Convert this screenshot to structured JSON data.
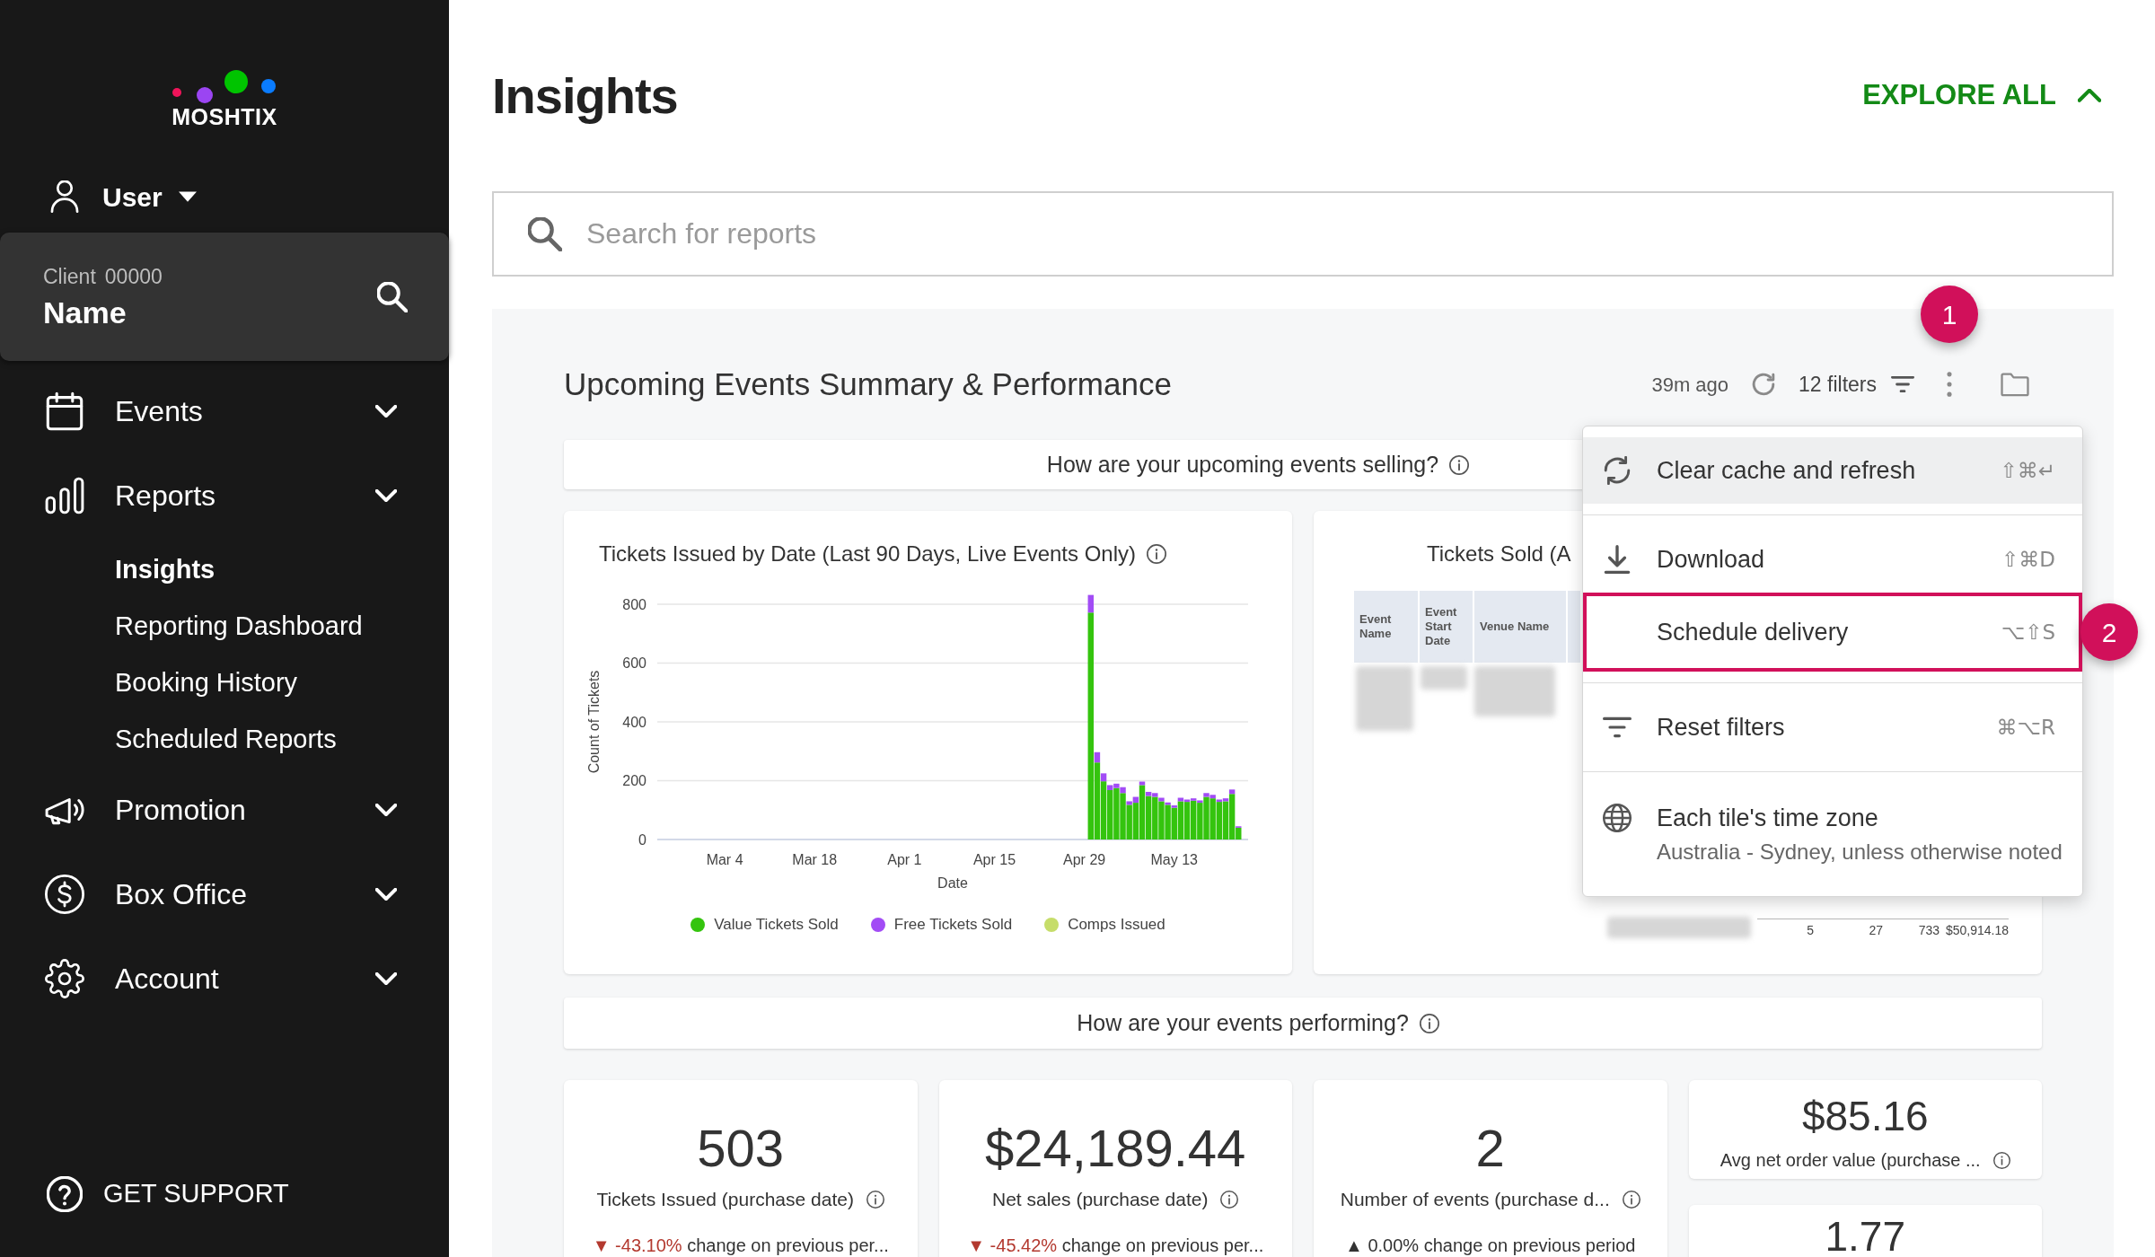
{
  "sidebar": {
    "brand": "MOSHTIX",
    "user": "User",
    "client": {
      "label": "Client",
      "number": "00000",
      "name": "Name"
    },
    "nav": [
      {
        "label": "Events"
      },
      {
        "label": "Reports",
        "children": [
          {
            "label": "Insights",
            "selected": true
          },
          {
            "label": "Reporting Dashboard",
            "selected": false
          },
          {
            "label": "Booking History",
            "selected": false
          },
          {
            "label": "Scheduled Reports",
            "selected": false
          }
        ]
      },
      {
        "label": "Promotion"
      },
      {
        "label": "Box Office"
      },
      {
        "label": "Account"
      }
    ],
    "support": "GET SUPPORT"
  },
  "page": {
    "title": "Insights",
    "explore_all": "EXPLORE ALL"
  },
  "search": {
    "placeholder": "Search for reports"
  },
  "dashboard": {
    "title": "Upcoming Events Summary & Performance",
    "updated": "39m ago",
    "filters": "12 filters",
    "more_callout": "1",
    "selling": {
      "heading": "How are your upcoming events selling?",
      "chart_tile": {
        "chart_data": {
          "type": "bar",
          "title": "Tickets Issued by Date (Last 90 Days, Live Events Only)",
          "xlabel": "Date",
          "ylabel": "Count of Tickets",
          "categories": [
            null,
            null,
            null,
            null,
            null,
            null,
            null,
            null,
            null,
            null,
            "Mar 4",
            null,
            null,
            null,
            null,
            null,
            null,
            null,
            null,
            null,
            null,
            null,
            null,
            null,
            "Mar 18",
            null,
            null,
            null,
            null,
            null,
            null,
            null,
            null,
            null,
            null,
            null,
            null,
            null,
            "Apr 1",
            null,
            null,
            null,
            null,
            null,
            null,
            null,
            null,
            null,
            null,
            null,
            null,
            null,
            "Apr 15",
            null,
            null,
            null,
            null,
            null,
            null,
            null,
            null,
            null,
            null,
            null,
            null,
            null,
            "Apr 29",
            null,
            null,
            null,
            null,
            null,
            null,
            null,
            null,
            null,
            null,
            null,
            null,
            null,
            "May 13",
            null,
            null,
            null,
            null,
            null,
            null,
            null,
            null,
            null,
            null,
            null
          ],
          "series": [
            {
              "name": "Value Tickets Sold",
              "color": "#34c40e",
              "values": [
                0,
                0,
                0,
                0,
                0,
                0,
                0,
                0,
                0,
                0,
                0,
                0,
                0,
                0,
                0,
                0,
                0,
                0,
                0,
                0,
                0,
                0,
                0,
                0,
                0,
                0,
                0,
                0,
                0,
                0,
                0,
                0,
                0,
                0,
                0,
                0,
                0,
                0,
                0,
                0,
                0,
                0,
                0,
                0,
                0,
                0,
                0,
                0,
                0,
                0,
                0,
                0,
                0,
                0,
                0,
                0,
                0,
                0,
                0,
                0,
                0,
                0,
                0,
                0,
                0,
                0,
                0,
                772,
                262,
                198,
                168,
                175,
                158,
                118,
                125,
                185,
                148,
                145,
                130,
                118,
                108,
                130,
                128,
                132,
                125,
                145,
                140,
                128,
                130,
                155,
                40,
                0
              ]
            },
            {
              "name": "Free Tickets Sold",
              "color": "#a24cf5",
              "values": [
                0,
                0,
                0,
                0,
                0,
                0,
                0,
                0,
                0,
                0,
                0,
                0,
                0,
                0,
                0,
                0,
                0,
                0,
                0,
                0,
                0,
                0,
                0,
                0,
                0,
                0,
                0,
                0,
                0,
                0,
                0,
                0,
                0,
                0,
                0,
                0,
                0,
                0,
                0,
                0,
                0,
                0,
                0,
                0,
                0,
                0,
                0,
                0,
                0,
                0,
                0,
                0,
                0,
                0,
                0,
                0,
                0,
                0,
                0,
                0,
                0,
                0,
                0,
                0,
                0,
                0,
                0,
                60,
                35,
                27,
                17,
                15,
                20,
                12,
                20,
                12,
                14,
                13,
                12,
                8,
                8,
                12,
                8,
                8,
                8,
                13,
                12,
                8,
                10,
                15,
                5,
                0
              ]
            },
            {
              "name": "Comps Issued",
              "color": "#c6dd6a",
              "values": [
                0,
                0,
                0,
                0,
                0,
                0,
                0,
                0,
                0,
                0,
                0,
                0,
                0,
                0,
                0,
                0,
                0,
                0,
                0,
                0,
                0,
                0,
                0,
                0,
                0,
                0,
                0,
                0,
                0,
                0,
                0,
                0,
                0,
                0,
                0,
                0,
                0,
                0,
                0,
                0,
                0,
                0,
                0,
                0,
                0,
                0,
                0,
                0,
                0,
                0,
                0,
                0,
                0,
                0,
                0,
                0,
                0,
                0,
                0,
                0,
                0,
                0,
                0,
                0,
                0,
                0,
                0,
                0,
                0,
                0,
                0,
                0,
                0,
                0,
                0,
                0,
                0,
                0,
                0,
                0,
                0,
                0,
                0,
                0,
                0,
                0,
                0,
                0,
                0,
                0,
                0,
                0
              ]
            }
          ],
          "ylim": [
            0,
            840
          ],
          "yticks": [
            0,
            200,
            400,
            600,
            800
          ],
          "stacked": true,
          "grid": true
        }
      },
      "table_tile": {
        "title": "Tickets Sold (A",
        "columns": [
          "Event Name",
          "Event Start Date",
          "Venue Name"
        ],
        "rows": [
          {
            "cells": [
              "5",
              "27",
              "733",
              "$50,914.18"
            ]
          }
        ]
      }
    },
    "performing": {
      "heading": "How are your events performing?",
      "kpis": [
        {
          "kind": "large",
          "value": "503",
          "label": "Tickets Issued (purchase date)",
          "arrow": "▼",
          "change": "-43.10%",
          "note": "change on previous per...",
          "negative": true
        },
        {
          "kind": "large",
          "value": "$24,189.44",
          "label": "Net sales (purchase date)",
          "arrow": "▼",
          "change": "-45.42%",
          "note": "change on previous per...",
          "negative": true
        },
        {
          "kind": "large",
          "value": "2",
          "label": "Number of events (purchase d...",
          "arrow": "▲",
          "change": "0.00%",
          "note": "change on previous period",
          "negative": false
        },
        {
          "kind": "compact",
          "value": "$85.16",
          "label": "Avg net order value (purchase ..."
        },
        {
          "kind": "compact",
          "value": "1.77"
        }
      ]
    }
  },
  "menu": {
    "sections": [
      {
        "items": [
          {
            "label": "Clear cache and refresh",
            "shortcut": "⇧⌘↵",
            "highlighted": true,
            "outlined": false
          }
        ]
      },
      {
        "items": [
          {
            "label": "Download",
            "shortcut": "⇧⌘D",
            "highlighted": false,
            "outlined": false
          },
          {
            "label": "Schedule delivery",
            "shortcut": "⌥⇧S",
            "highlighted": false,
            "outlined": true,
            "callout": "2"
          }
        ]
      },
      {
        "items": [
          {
            "label": "Reset filters",
            "shortcut": "⌘⌥R",
            "highlighted": false,
            "outlined": false
          }
        ]
      },
      {
        "items": [
          {
            "label": "Each tile's time zone",
            "detail": "Australia - Sydney, unless otherwise noted",
            "highlighted": false,
            "outlined": false
          }
        ]
      }
    ]
  }
}
